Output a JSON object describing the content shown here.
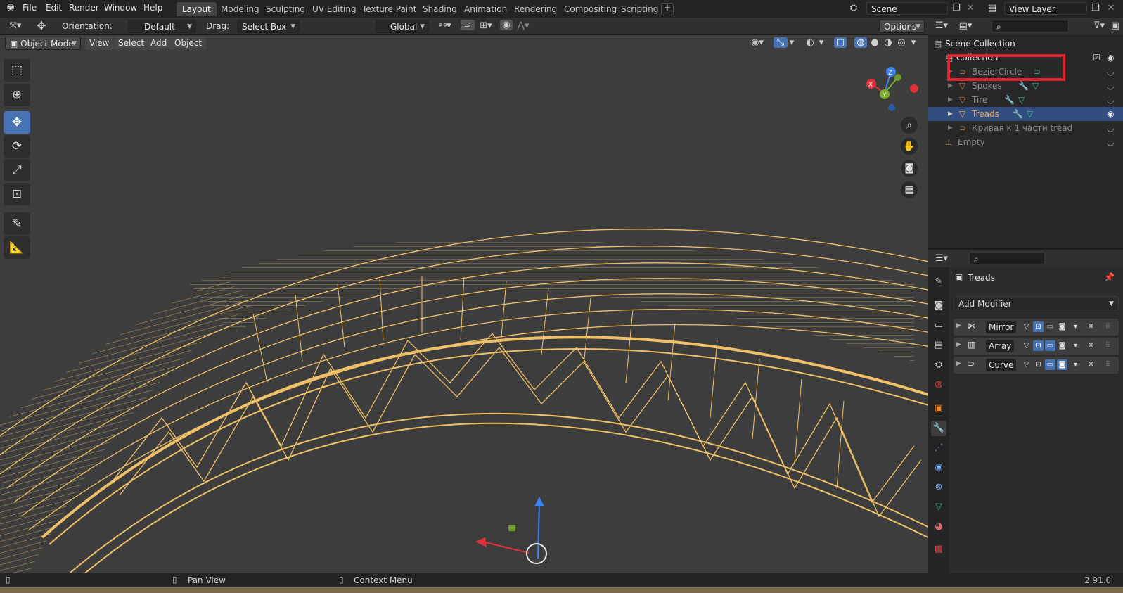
{
  "app": {
    "version": "2.91.0"
  },
  "menu": [
    "File",
    "Edit",
    "Render",
    "Window",
    "Help"
  ],
  "workspaces": [
    "Layout",
    "Modeling",
    "Sculpting",
    "UV Editing",
    "Texture Paint",
    "Shading",
    "Animation",
    "Rendering",
    "Compositing",
    "Scripting"
  ],
  "scene": {
    "name": "Scene",
    "view_layer": "View Layer"
  },
  "tool_header": {
    "orientation_label": "Orientation:",
    "orientation_value": "Default",
    "drag_label": "Drag:",
    "drag_value": "Select Box",
    "transform_orientation": "Global",
    "options": "Options"
  },
  "view_header": {
    "mode": "Object Mode",
    "items": [
      "View",
      "Select",
      "Add",
      "Object"
    ]
  },
  "gizmo": {
    "z": "Z",
    "y": "Y",
    "x": "X"
  },
  "outliner": {
    "root": "Scene Collection",
    "collection": "Collection",
    "items": [
      {
        "name": "BezierCircle",
        "type": "curve",
        "selected": false
      },
      {
        "name": "Spokes",
        "type": "mesh",
        "selected": false
      },
      {
        "name": "Tire",
        "type": "mesh",
        "selected": false
      },
      {
        "name": "Treads",
        "type": "mesh",
        "selected": true
      },
      {
        "name": "Кривая к 1 части tread",
        "type": "curve",
        "selected": false
      }
    ],
    "empty": "Empty"
  },
  "properties": {
    "object_name": "Treads",
    "add_modifier": "Add Modifier",
    "modifiers": [
      "Mirror",
      "Array",
      "Curve"
    ]
  },
  "statusbar": {
    "pan": "Pan View",
    "context": "Context Menu"
  },
  "colors": {
    "accent": "#4772b3",
    "wire": "#f0c068",
    "highlight_box": "#e0202a",
    "selected_text": "#f1a95a"
  }
}
